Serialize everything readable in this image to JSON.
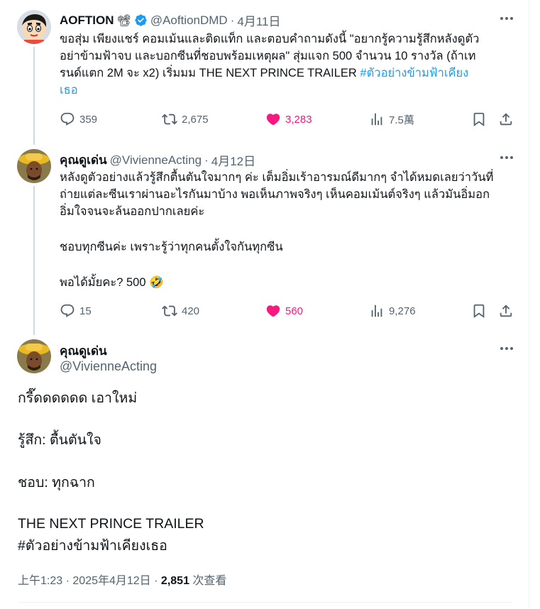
{
  "tweets": [
    {
      "display_name": "AOFTION",
      "name_emoji": "📽",
      "handle": "@AoftionDMD",
      "date": "4月11日",
      "text_lines": [
        "ขอสุ่ม เพียงแชร์ คอมเม้นและติดแท็ก และตอบคำถามดังนี้ \"อยากรู้ความรู้สึกหลังดูตัว",
        "อย่าข้ามฟ้าจบ และบอกซีนที่ชอบพร้อมเหตุผล\" สุ่มแจก 500 จำนวน 10 รางวัล (ถ้าเท",
        "รนด์แตก 2M จะ x2) เริ่มมม  THE NEXT PRINCE TRAILER "
      ],
      "hashtag_a": "#ตัวอย่างข้ามฟ้าเคียง",
      "hashtag_b": "เธอ",
      "replies": "359",
      "retweets": "2,675",
      "likes": "3,283",
      "views": "7.5萬"
    },
    {
      "display_name": "คุณดูเด่น",
      "handle": "@VivienneActing",
      "date": "4月12日",
      "text_lines": [
        "หลังดูตัวอย่างแล้วรู้สึกตื้นตันใจมากๆ ค่ะ เต็มอิ่มเร้าอารมณ์ดีมากๆ จำได้หมดเลยว่าวันที่",
        "ถ่ายแต่ละซีนเราผ่านอะไรกันมาบ้าง พอเห็นภาพจริงๆ เห็นคอมเม้นต์จริงๆ แล้วมันอิ่มอก",
        "อิ่มใจจนจะล้นออกปากเลยค่ะ",
        "ชอบทุกซีนค่ะ เพราะรู้ว่าทุกคนตั้งใจกันทุกซีน",
        "พอได้มั้ยคะ? 500 🤣"
      ],
      "replies": "15",
      "retweets": "420",
      "likes": "560",
      "views": "9,276"
    }
  ],
  "main": {
    "display_name": "คุณดูเด่น",
    "handle": "@VivienneActing",
    "lines": [
      "กรี๊ดดดดดด เอาใหม่",
      "รู้สึก: ตื้นตันใจ",
      "ชอบ: ทุกฉาก",
      "THE NEXT PRINCE TRAILER"
    ],
    "hashtag": "#ตัวอย่างข้ามฟ้าเคียงเธอ",
    "time": "上午1:23",
    "date": "2025年4月12日",
    "views_count": "2,851",
    "views_label": "次查看"
  },
  "colors": {
    "accent": "#1d9bf0",
    "like": "#f91880",
    "muted": "#536471"
  }
}
